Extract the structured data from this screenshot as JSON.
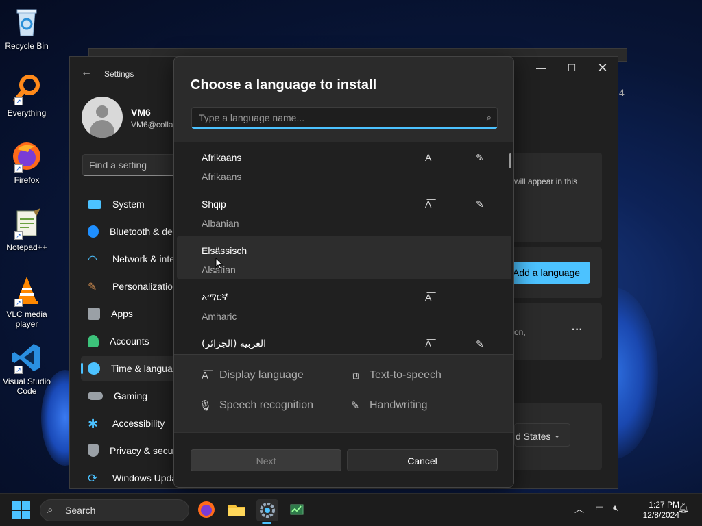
{
  "desktop": {
    "icons": [
      {
        "label": "Recycle Bin",
        "icon": "recycle-bin-icon"
      },
      {
        "label": "Everything",
        "icon": "everything-search-icon"
      },
      {
        "label": "Firefox",
        "icon": "firefox-icon"
      },
      {
        "label": "Notepad++",
        "icon": "notepad-plus-plus-icon"
      },
      {
        "label": "VLC media player",
        "icon": "vlc-icon"
      },
      {
        "label": "Visual Studio Code",
        "icon": "vscode-icon"
      }
    ]
  },
  "settings": {
    "title": "Settings",
    "user": {
      "name": "VM6",
      "email": "VM6@collab"
    },
    "search_placeholder": "Find a setting",
    "nav": [
      {
        "label": "System",
        "icon": "system-icon",
        "color": "#4cc2ff"
      },
      {
        "label": "Bluetooth & de",
        "icon": "bluetooth-icon",
        "color": "#1f8fff"
      },
      {
        "label": "Network & inte",
        "icon": "wifi-icon",
        "color": "#4cc2ff"
      },
      {
        "label": "Personalization",
        "icon": "brush-icon",
        "color": "#d08c4f"
      },
      {
        "label": "Apps",
        "icon": "apps-icon",
        "color": "#9aa0a6"
      },
      {
        "label": "Accounts",
        "icon": "accounts-icon",
        "color": "#3cc27a"
      },
      {
        "label": "Time & languag",
        "icon": "time-language-icon",
        "color": "#4cc2ff"
      },
      {
        "label": "Gaming",
        "icon": "gaming-icon",
        "color": "#9aa0a6"
      },
      {
        "label": "Accessibility",
        "icon": "accessibility-icon",
        "color": "#4cc2ff"
      },
      {
        "label": "Privacy & secu",
        "icon": "shield-icon",
        "color": "#9aa0a6"
      },
      {
        "label": "Windows Upda",
        "icon": "windows-update-icon",
        "color": "#4cc2ff"
      }
    ],
    "active_nav_index": 6,
    "right": {
      "badge": "4",
      "card1_text": "will appear in this",
      "add_language_label": "Add a language",
      "card2_text": "on,",
      "more_label": "···",
      "region_value": "d States",
      "accent_color": "#4cc2ff"
    }
  },
  "dialog": {
    "title": "Choose a language to install",
    "search_placeholder": "Type a language name...",
    "languages": [
      {
        "native": "Afrikaans",
        "english": "Afrikaans",
        "display_language": true,
        "handwriting": true
      },
      {
        "native": "Shqip",
        "english": "Albanian",
        "display_language": true,
        "handwriting": true
      },
      {
        "native": "Elsässisch",
        "english": "Alsatian",
        "display_language": false,
        "handwriting": false
      },
      {
        "native": "አማርኛ",
        "english": "Amharic",
        "display_language": true,
        "handwriting": false
      },
      {
        "native": "العربية (الجزائر)",
        "english": "",
        "display_language": true,
        "handwriting": true
      }
    ],
    "hovered_index": 2,
    "features": {
      "display_language": "Display language",
      "text_to_speech": "Text-to-speech",
      "speech_recognition": "Speech recognition",
      "handwriting": "Handwriting"
    },
    "next_label": "Next",
    "cancel_label": "Cancel"
  },
  "taskbar": {
    "search_label": "Search",
    "apps": [
      "firefox-icon",
      "file-explorer-icon",
      "settings-icon",
      "task-manager-icon"
    ],
    "active_app": "settings-icon",
    "time": "1:27 PM",
    "date": "12/8/2024"
  }
}
